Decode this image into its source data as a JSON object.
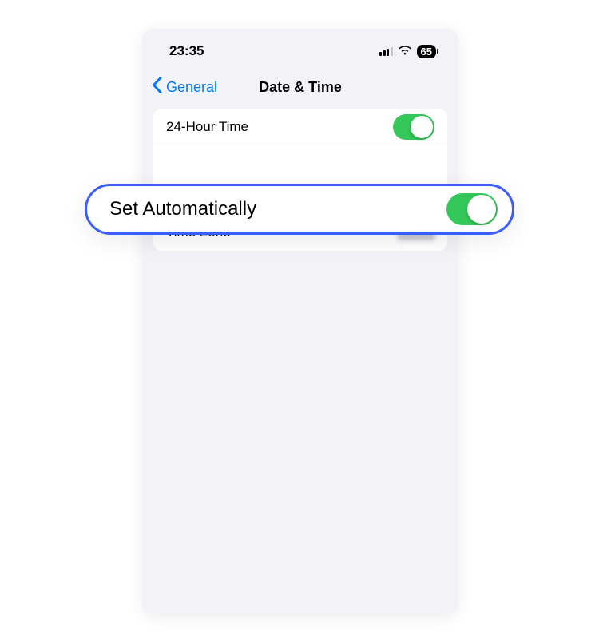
{
  "status_bar": {
    "time": "23:35",
    "battery": "65"
  },
  "nav": {
    "back_label": "General",
    "title": "Date & Time"
  },
  "rows": {
    "twenty_four_hour": {
      "label": "24-Hour Time",
      "on": true
    },
    "set_automatically": {
      "label": "Set Automatically",
      "on": true
    },
    "time_zone": {
      "label": "Time Zone"
    }
  },
  "colors": {
    "accent": "#007aff",
    "toggle_on": "#34c759",
    "highlight_border": "#3b5dff",
    "background": "#f2f2f7"
  }
}
